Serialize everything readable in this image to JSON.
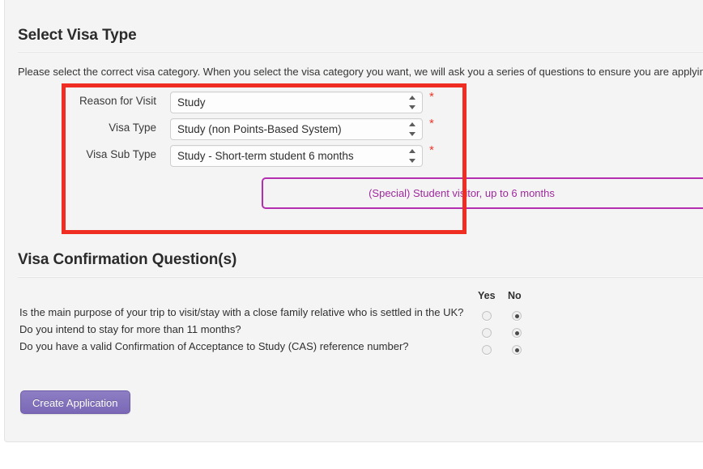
{
  "panel": {
    "sections": [
      {
        "id": "visa-type",
        "title": "Select Visa Type"
      },
      {
        "id": "visa-questions",
        "title": "Visa Confirmation Question(s)"
      }
    ],
    "intro": "Please select the correct visa category. When you select the visa category you want, we will ask you a series of questions to ensure you are applying for"
  },
  "form": {
    "required_marker": "*",
    "rows": [
      {
        "label": "Reason for Visit",
        "value": "Study",
        "required": true,
        "icon": "stepper-updown-icon"
      },
      {
        "label": "Visa Type",
        "value": "Study (non Points-Based System)",
        "required": true,
        "icon": "stepper-updown-icon"
      },
      {
        "label": "Visa Sub Type",
        "value": "Study - Short-term student 6 months",
        "required": true,
        "icon": "stepper-updown-icon"
      }
    ]
  },
  "highlight": {
    "text": "(Special) Student visitor, up to 6 months",
    "border_color": "#b32fb0",
    "text_color": "#a0299e"
  },
  "questions": {
    "columns": [
      "Yes",
      "No"
    ],
    "items": [
      {
        "text": "Is the main purpose of your trip to visit/stay with a close family relative who is settled in the UK?",
        "answer": "No"
      },
      {
        "text": "Do you intend to stay for more than 11 months?",
        "answer": "No"
      },
      {
        "text": "Do you have a valid Confirmation of Acceptance to Study (CAS) reference number?",
        "answer": "No"
      }
    ]
  },
  "actions": {
    "submit_label": "Create Application",
    "submit_color": "#7a68b6"
  },
  "annotation": {
    "type": "red-rectangle-highlight",
    "color": "#ef2d22"
  }
}
